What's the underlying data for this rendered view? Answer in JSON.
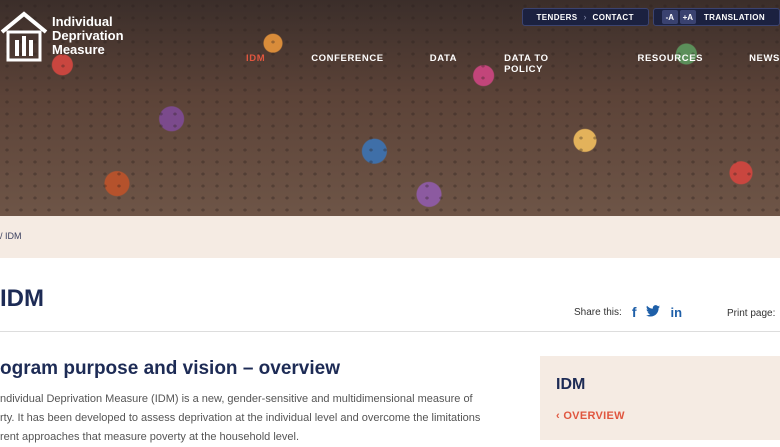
{
  "header": {
    "logo_lines": [
      "Individual",
      "Deprivation",
      "Measure"
    ],
    "top_links": {
      "tenders": "TENDERS",
      "contact": "CONTACT"
    },
    "font_controls": {
      "decrease": "-A",
      "increase": "+A"
    },
    "translation": "TRANSLATION",
    "nav": [
      {
        "label": "IDM",
        "active": true
      },
      {
        "label": "CONFERENCE",
        "active": false
      },
      {
        "label": "DATA",
        "active": false
      },
      {
        "label": "DATA TO POLICY",
        "active": false
      },
      {
        "label": "RESOURCES",
        "active": false
      },
      {
        "label": "NEWS",
        "active": false
      }
    ]
  },
  "breadcrumb": "/ IDM",
  "page_title": "IDM",
  "share": {
    "label": "Share this:",
    "icons": [
      "facebook-icon",
      "twitter-icon",
      "linkedin-icon"
    ],
    "print_label": "Print page:"
  },
  "section": {
    "title": "ogram purpose and vision – overview",
    "paragraph_lines": [
      "ndividual Deprivation Measure (IDM) is a new, gender-sensitive and multidimensional measure of",
      "rty. It has been developed to assess deprivation at the individual level and overcome the limitations",
      "rent approaches that measure poverty at the household level."
    ]
  },
  "side_panel": {
    "title": "IDM",
    "link": "OVERVIEW"
  },
  "colors": {
    "navy": "#1d2b55",
    "accent": "#e0563f",
    "band": "#f5ebe3"
  }
}
